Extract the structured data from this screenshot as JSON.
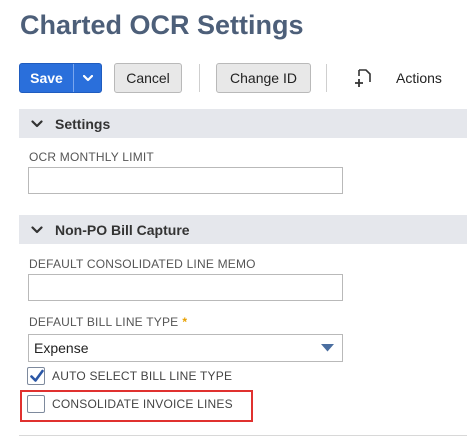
{
  "page": {
    "title": "Charted OCR Settings"
  },
  "toolbar": {
    "save_label": "Save",
    "cancel_label": "Cancel",
    "change_id_label": "Change ID",
    "actions_label": "Actions"
  },
  "sections": {
    "settings": {
      "title": "Settings",
      "fields": {
        "ocr_monthly_limit": {
          "label": "OCR MONTHLY LIMIT",
          "value": ""
        }
      }
    },
    "non_po": {
      "title": "Non-PO Bill Capture",
      "fields": {
        "default_memo": {
          "label": "DEFAULT CONSOLIDATED LINE MEMO",
          "value": ""
        },
        "default_line_type": {
          "label": "DEFAULT BILL LINE TYPE",
          "required_mark": "*",
          "value": "Expense"
        },
        "auto_select": {
          "label": "AUTO SELECT BILL LINE TYPE",
          "checked": true
        },
        "consolidate": {
          "label": "CONSOLIDATE INVOICE LINES",
          "checked": false
        }
      }
    }
  },
  "colors": {
    "primary": "#2a6fdb",
    "title": "#4d5f79",
    "section_bg": "#e5e7ec",
    "required": "#e8a000",
    "highlight": "#e0312f"
  }
}
